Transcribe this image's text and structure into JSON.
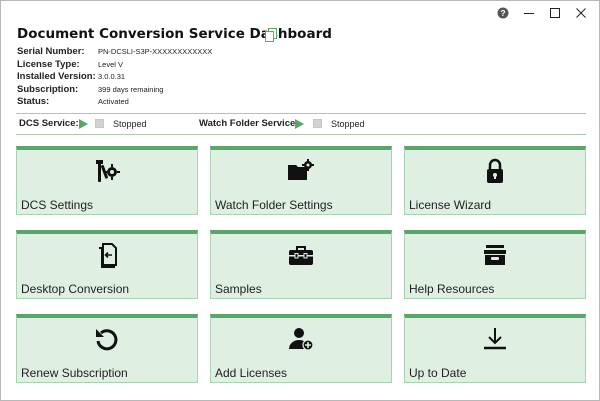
{
  "window": {
    "controls": {
      "help_icon": "question-circle-icon",
      "minimize_icon": "minimize-icon",
      "maximize_icon": "maximize-icon",
      "close_icon": "close-icon"
    }
  },
  "header": {
    "title": "Document Conversion Service Dashboard",
    "copy_icon": "copy-icon"
  },
  "info": [
    {
      "label": "Serial Number:",
      "value": "PN-DCSLI-S3P-XXXXXXXXXXXX"
    },
    {
      "label": "License Type:",
      "value": "Level V"
    },
    {
      "label": "Installed Version:",
      "value": "3.0.0.31"
    },
    {
      "label": "Subscription:",
      "value": "399 days remaining"
    },
    {
      "label": "Status:",
      "value": "Activated"
    }
  ],
  "services": {
    "dcs": {
      "label": "DCS Service:",
      "status": "Stopped"
    },
    "watch": {
      "label": "Watch Folder Service:",
      "status": "Stopped"
    }
  },
  "tiles": [
    {
      "label": "DCS Settings",
      "icon": "tools-gear-icon"
    },
    {
      "label": "Watch Folder Settings",
      "icon": "folder-gear-icon"
    },
    {
      "label": "License Wizard",
      "icon": "lock-icon"
    },
    {
      "label": "Desktop Conversion",
      "icon": "document-convert-icon"
    },
    {
      "label": "Samples",
      "icon": "toolbox-icon"
    },
    {
      "label": "Help Resources",
      "icon": "archive-box-icon"
    },
    {
      "label": "Renew Subscription",
      "icon": "refresh-icon"
    },
    {
      "label": "Add Licenses",
      "icon": "add-user-icon"
    },
    {
      "label": "Up to Date",
      "icon": "download-icon"
    }
  ],
  "colors": {
    "accent": "#5aa56a",
    "tile_background": "#dff0e3",
    "tile_border": "#a8d2b2",
    "divider": "#a9c9b1",
    "stop_square": "#d3d3d3"
  }
}
